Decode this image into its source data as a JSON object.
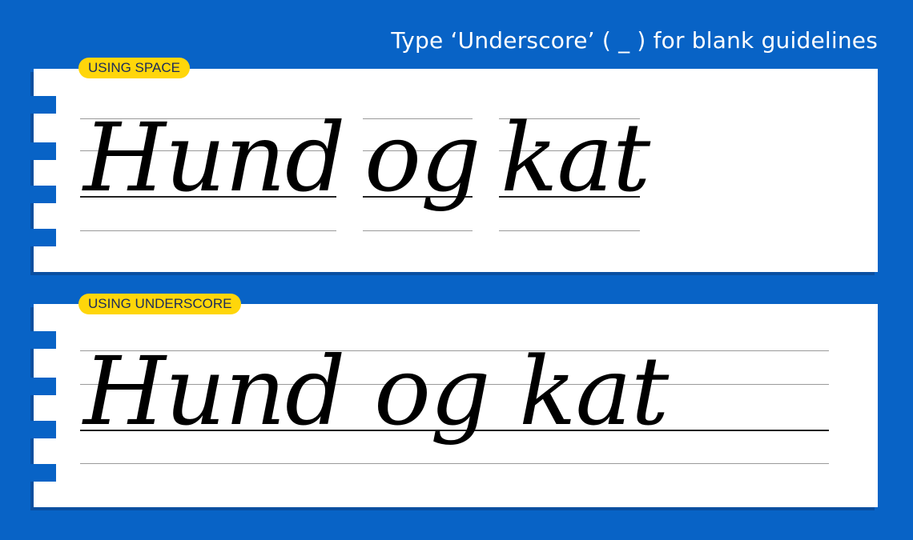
{
  "header": {
    "text": "Type ‘Underscore’ ( _ ) for blank guidelines"
  },
  "examples": [
    {
      "badge": "USING SPACE",
      "words": [
        "Hund",
        "og",
        "kat"
      ]
    },
    {
      "badge": "USING UNDERSCORE",
      "text": "Hund og kat"
    }
  ],
  "colors": {
    "background": "#0863c6",
    "badge": "#ffd60a",
    "card": "#ffffff"
  }
}
